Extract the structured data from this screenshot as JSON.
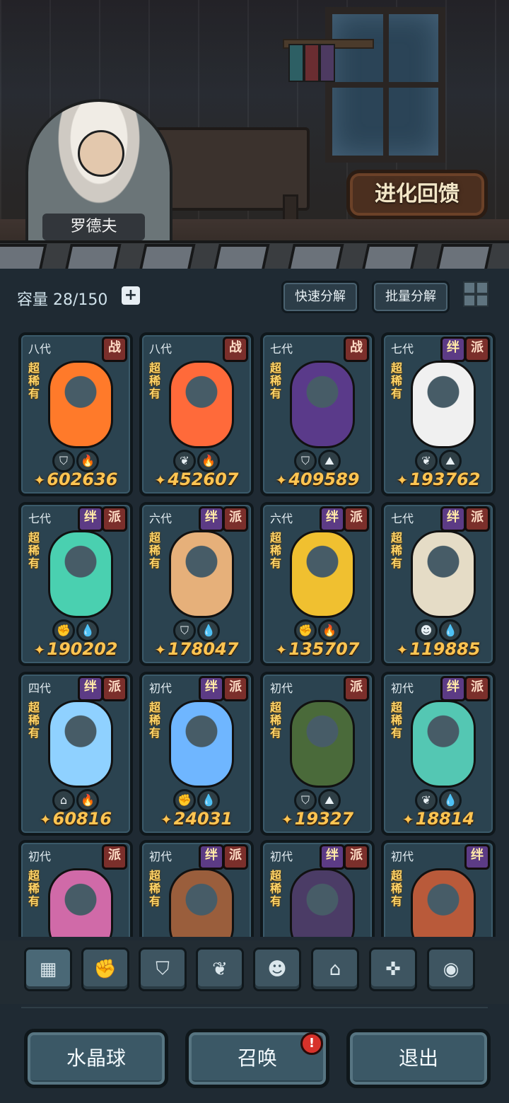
{
  "npc_name": "罗德夫",
  "evolve_feedback_label": "进化回馈",
  "capacity": {
    "label": "容量",
    "value": "28/150"
  },
  "toolbar": {
    "quick_decompose": "快速分解",
    "batch_decompose": "批量分解"
  },
  "cards": [
    {
      "gen": "八代",
      "tags": [
        "战"
      ],
      "rarity": "超稀有",
      "icons": [
        "shield-icon",
        "fire-icon"
      ],
      "power": "602636",
      "portrait_color": "#ff7a2a"
    },
    {
      "gen": "八代",
      "tags": [
        "战"
      ],
      "rarity": "超稀有",
      "icons": [
        "leaf-icon",
        "fire-icon"
      ],
      "power": "452607",
      "portrait_color": "#ff6a3a"
    },
    {
      "gen": "七代",
      "tags": [
        "战"
      ],
      "rarity": "超稀有",
      "icons": [
        "shield-icon",
        "earth-icon"
      ],
      "power": "409589",
      "portrait_color": "#5a3a8a"
    },
    {
      "gen": "七代",
      "tags": [
        "绊",
        "派"
      ],
      "rarity": "超稀有",
      "icons": [
        "leaf-icon",
        "earth-icon"
      ],
      "power": "193762",
      "portrait_color": "#f0f0f0"
    },
    {
      "gen": "七代",
      "tags": [
        "绊",
        "派"
      ],
      "rarity": "超稀有",
      "icons": [
        "fist-icon",
        "water-icon"
      ],
      "power": "190202",
      "portrait_color": "#4ad0b0"
    },
    {
      "gen": "六代",
      "tags": [
        "绊",
        "派"
      ],
      "rarity": "超稀有",
      "icons": [
        "shield-icon",
        "water-icon"
      ],
      "power": "178047",
      "portrait_color": "#e6b07a"
    },
    {
      "gen": "六代",
      "tags": [
        "绊",
        "派"
      ],
      "rarity": "超稀有",
      "icons": [
        "fist-icon",
        "fire-icon"
      ],
      "power": "135707",
      "portrait_color": "#f0c030"
    },
    {
      "gen": "七代",
      "tags": [
        "绊",
        "派"
      ],
      "rarity": "超稀有",
      "icons": [
        "mask-icon",
        "water-icon"
      ],
      "power": "119885",
      "portrait_color": "#e5dcc6"
    },
    {
      "gen": "四代",
      "tags": [
        "绊",
        "派"
      ],
      "rarity": "超稀有",
      "icons": [
        "tower-icon",
        "fire-icon"
      ],
      "power": "60816",
      "portrait_color": "#8fd1ff"
    },
    {
      "gen": "初代",
      "tags": [
        "绊",
        "派"
      ],
      "rarity": "超稀有",
      "icons": [
        "fist-icon",
        "water-icon"
      ],
      "power": "24031",
      "portrait_color": "#6fb6ff"
    },
    {
      "gen": "初代",
      "tags": [
        "派"
      ],
      "rarity": "超稀有",
      "icons": [
        "shield-icon",
        "earth-icon"
      ],
      "power": "19327",
      "portrait_color": "#4a6a3a"
    },
    {
      "gen": "初代",
      "tags": [
        "绊",
        "派"
      ],
      "rarity": "超稀有",
      "icons": [
        "leaf-icon",
        "water-icon"
      ],
      "power": "18814",
      "portrait_color": "#54c7b3"
    },
    {
      "gen": "初代",
      "tags": [
        "派"
      ],
      "rarity": "超稀有",
      "icons": [],
      "power": "",
      "portrait_color": "#d06aa8"
    },
    {
      "gen": "初代",
      "tags": [
        "绊",
        "派"
      ],
      "rarity": "超稀有",
      "icons": [],
      "power": "",
      "portrait_color": "#9a5e3c"
    },
    {
      "gen": "初代",
      "tags": [
        "绊",
        "派"
      ],
      "rarity": "超稀有",
      "icons": [],
      "power": "",
      "portrait_color": "#4b3c66"
    },
    {
      "gen": "初代",
      "tags": [
        "绊"
      ],
      "rarity": "超稀有",
      "icons": [],
      "power": "",
      "portrait_color": "#b95a3a"
    }
  ],
  "filters": [
    {
      "icon": "stack-icon",
      "active": true
    },
    {
      "icon": "fist-icon",
      "active": false
    },
    {
      "icon": "shield-icon",
      "active": false
    },
    {
      "icon": "leaf-icon",
      "active": false
    },
    {
      "icon": "mask-icon",
      "active": false
    },
    {
      "icon": "tower-icon",
      "active": false
    },
    {
      "icon": "crosshair-icon",
      "active": false
    },
    {
      "icon": "eye-icon",
      "active": false
    }
  ],
  "bottom_buttons": {
    "crystal_ball": "水晶球",
    "summon": "召唤",
    "exit": "退出"
  },
  "summon_badge": "!"
}
